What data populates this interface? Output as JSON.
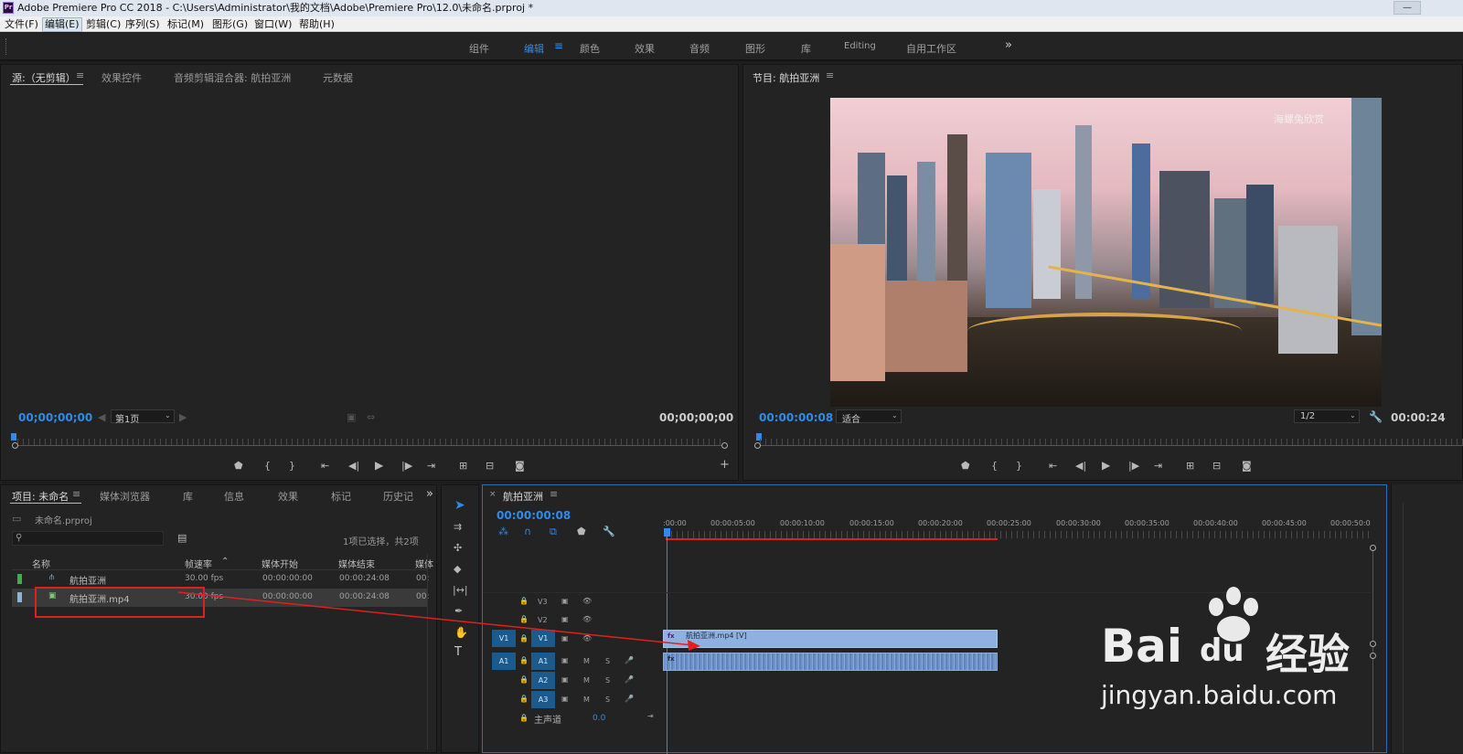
{
  "window": {
    "title": "Adobe Premiere Pro CC 2018 - C:\\Users\\Administrator\\我的文档\\Adobe\\Premiere Pro\\12.0\\未命名.prproj *",
    "controls": [
      "—",
      "☐",
      "✕"
    ]
  },
  "menu": {
    "items": [
      "文件(F)",
      "编辑(E)",
      "剪辑(C)",
      "序列(S)",
      "标记(M)",
      "图形(G)",
      "窗口(W)",
      "帮助(H)"
    ]
  },
  "workspaces": {
    "items": [
      "组件",
      "编辑",
      "颜色",
      "效果",
      "音频",
      "图形",
      "库",
      "Editing",
      "自用工作区"
    ],
    "more": "»"
  },
  "source": {
    "tabs": [
      "源:（无剪辑）",
      "效果控件",
      "音频剪辑混合器: 航拍亚洲",
      "元数据"
    ],
    "timecode_left": "00;00;00;00",
    "page": "第1页",
    "timecode_right": "00;00;00;00"
  },
  "program": {
    "tab": "节目: 航拍亚洲",
    "timecode": "00:00:00:08",
    "fit": "适合",
    "quality": "1/2",
    "duration": "00:00:24",
    "watermark": "海螺兔欣赏"
  },
  "project": {
    "tabs": [
      "项目: 未命名",
      "媒体浏览器",
      "库",
      "信息",
      "效果",
      "标记",
      "历史记"
    ],
    "file": "未命名.prproj",
    "selection": "1项已选择，共2项",
    "columns": [
      "名称",
      "帧速率",
      "媒体开始",
      "媒体结束",
      "媒体"
    ],
    "rows": [
      {
        "name": "航拍亚洲",
        "fps": "30.00 fps",
        "start": "00:00:00:00",
        "end": "00:00:24:08",
        "extra": "00:"
      },
      {
        "name": "航拍亚洲.mp4",
        "fps": "30.00 fps",
        "start": "00:00:00:00",
        "end": "00:00:24:08",
        "extra": "00:"
      }
    ]
  },
  "timeline": {
    "tab": "航拍亚洲",
    "timecode": "00:00:00:08",
    "ruler": [
      ":00:00",
      "00:00:05:00",
      "00:00:10:00",
      "00:00:15:00",
      "00:00:20:00",
      "00:00:25:00",
      "00:00:30:00",
      "00:00:35:00",
      "00:00:40:00",
      "00:00:45:00",
      "00:00:50:0"
    ],
    "video_tracks": [
      "V3",
      "V2",
      "V1"
    ],
    "audio_tracks": [
      "A1",
      "A2",
      "A3"
    ],
    "src_v": "V1",
    "src_a": "A1",
    "master": "主声道",
    "master_val": "0.0",
    "clip_video": "航拍亚洲.mp4 [V]",
    "m": "M",
    "s": "S"
  },
  "watermark": {
    "brand_left": "Bai",
    "brand_du": "du",
    "brand_right": "经验",
    "url": "jingyan.baidu.com"
  },
  "colors": {
    "accent": "#2d8ceb",
    "clip_video": "#8fb1df",
    "clip_audio": "#6f93c9",
    "annotation": "#e02020"
  }
}
